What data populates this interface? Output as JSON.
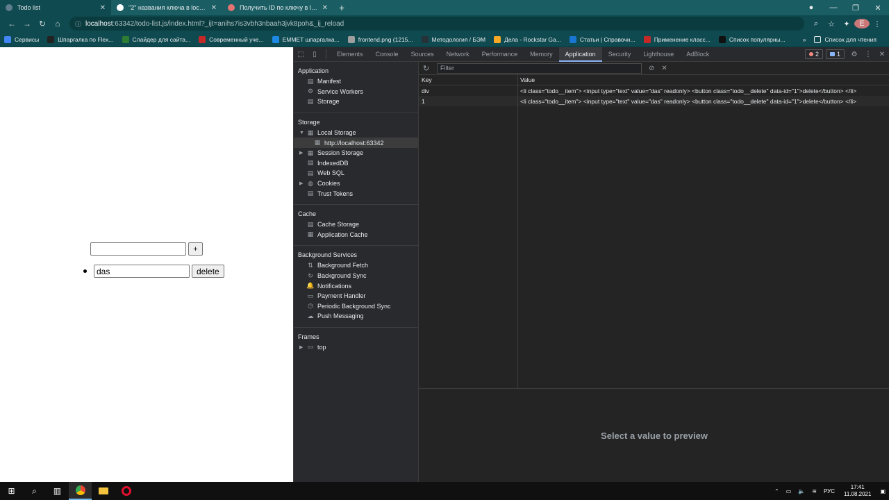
{
  "browser": {
    "tabs": [
      {
        "title": "Todo list",
        "color": "#607d8b",
        "active": true
      },
      {
        "title": "\"2\" названия ключа в localstorage",
        "color": "#ffffff",
        "active": false
      },
      {
        "title": "Получить ID по ключу в localStorage",
        "color": "#e57373",
        "active": false
      }
    ],
    "url_host": "localhost",
    "url_rest": ":63342/todo-list.js/index.html?_ijt=anihs7is3vbh3nbaah3jvk8poh&_ij_reload",
    "avatar_letter": "E",
    "bookmarks": [
      {
        "label": "Сервисы",
        "color": "#4285f4"
      },
      {
        "label": "Шпаргалка по Flex...",
        "color": "#222222"
      },
      {
        "label": "Слайдер для сайта...",
        "color": "#2e7d32"
      },
      {
        "label": "Современный уче...",
        "color": "#c62828"
      },
      {
        "label": "EMMET шпаргалка...",
        "color": "#1e88e5"
      },
      {
        "label": "frontend.png (1215...",
        "color": "#9e9e9e"
      },
      {
        "label": "Методология / БЭМ",
        "color": "#263238"
      },
      {
        "label": "Дела - Rockstar Ga...",
        "color": "#f9a825"
      },
      {
        "label": "Статьи | Справочн...",
        "color": "#1976d2"
      },
      {
        "label": "Применение класс...",
        "color": "#c62828"
      },
      {
        "label": "Список популярны...",
        "color": "#111111"
      }
    ],
    "bookmarks_more": "»",
    "reading_list": "Список для чтения"
  },
  "page": {
    "add_button": "+",
    "todo_items": [
      {
        "value": "das",
        "delete_label": "delete"
      }
    ]
  },
  "devtools": {
    "tabs": [
      "Elements",
      "Console",
      "Sources",
      "Network",
      "Performance",
      "Memory",
      "Application",
      "Security",
      "Lighthouse",
      "AdBlock"
    ],
    "active_tab": "Application",
    "error_count": "2",
    "message_count": "1",
    "sidebar": {
      "application_title": "Application",
      "application_items": [
        {
          "label": "Manifest",
          "icon": "file-icon"
        },
        {
          "label": "Service Workers",
          "icon": "gear-icon"
        },
        {
          "label": "Storage",
          "icon": "database-icon"
        }
      ],
      "storage_title": "Storage",
      "local_storage": "Local Storage",
      "local_storage_origin": "http://localhost:63342",
      "storage_items": [
        {
          "label": "Session Storage",
          "icon": "grid-icon",
          "expandable": true
        },
        {
          "label": "IndexedDB",
          "icon": "database-icon",
          "expandable": false
        },
        {
          "label": "Web SQL",
          "icon": "database-icon",
          "expandable": false
        },
        {
          "label": "Cookies",
          "icon": "cookie-icon",
          "expandable": true
        },
        {
          "label": "Trust Tokens",
          "icon": "database-icon",
          "expandable": false
        }
      ],
      "cache_title": "Cache",
      "cache_items": [
        {
          "label": "Cache Storage",
          "icon": "database-icon"
        },
        {
          "label": "Application Cache",
          "icon": "grid-icon"
        }
      ],
      "bg_title": "Background Services",
      "bg_items": [
        {
          "label": "Background Fetch",
          "icon": "fetch-icon"
        },
        {
          "label": "Background Sync",
          "icon": "sync-icon"
        },
        {
          "label": "Notifications",
          "icon": "bell-icon"
        },
        {
          "label": "Payment Handler",
          "icon": "card-icon"
        },
        {
          "label": "Periodic Background Sync",
          "icon": "clock-icon"
        },
        {
          "label": "Push Messaging",
          "icon": "cloud-icon"
        }
      ],
      "frames_title": "Frames",
      "frames_item": "top"
    },
    "filter_placeholder": "Filter",
    "table": {
      "key_header": "Key",
      "value_header": "Value",
      "rows": [
        {
          "key": "div",
          "value": "<li class=\"todo__item\"> <input type=\"text\" value=\"das\" readonly> <button class=\"todo__delete\" data-id=\"1\">delete</button> </li>"
        },
        {
          "key": "1",
          "value": "<li class=\"todo__item\"> <input type=\"text\" value=\"das\" readonly> <button class=\"todo__delete\" data-id=\"1\">delete</button> </li>"
        }
      ]
    },
    "preview_text": "Select a value to preview"
  },
  "taskbar": {
    "language": "РУС",
    "time": "17:41",
    "date": "11.08.2021"
  }
}
